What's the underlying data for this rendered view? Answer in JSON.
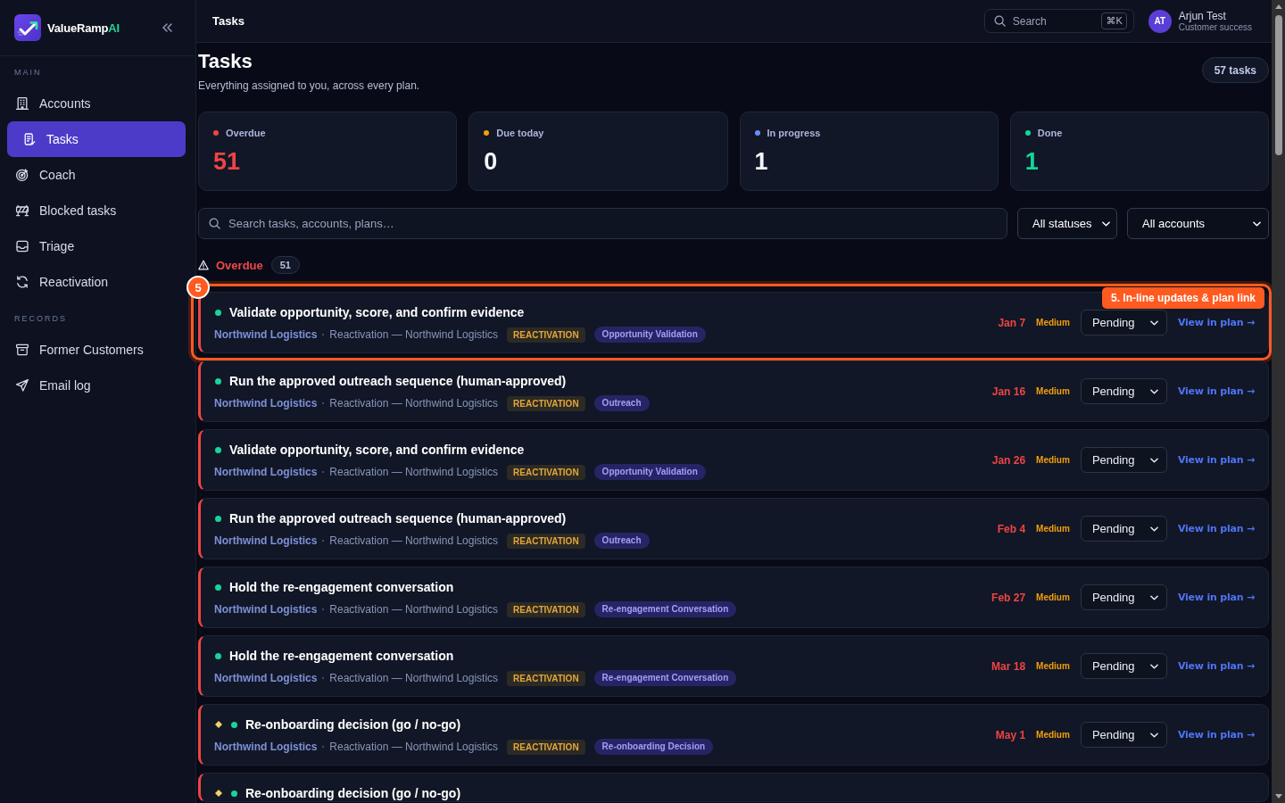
{
  "sidebar": {
    "brand": {
      "name": "ValueRamp",
      "accent": "AI"
    },
    "sections": [
      {
        "label": "MAIN",
        "items": [
          {
            "label": "Accounts",
            "selected": false
          },
          {
            "label": "Tasks",
            "selected": true
          },
          {
            "label": "Coach",
            "selected": false
          },
          {
            "label": "Blocked tasks",
            "selected": false
          },
          {
            "label": "Triage",
            "selected": false
          },
          {
            "label": "Reactivation",
            "selected": false
          }
        ]
      },
      {
        "label": "RECORDS",
        "items": [
          {
            "label": "Former Customers",
            "selected": false
          },
          {
            "label": "Email log",
            "selected": false
          }
        ]
      }
    ]
  },
  "header": {
    "title": "Tasks",
    "search": {
      "placeholder": "Search",
      "shortcut": "⌘K"
    },
    "user": {
      "initials": "AT",
      "name": "Arjun Test",
      "role": "Customer success"
    }
  },
  "page": {
    "title": "Tasks",
    "subtitle": "Everything assigned to you, across every plan.",
    "count": "57 tasks"
  },
  "stats": [
    {
      "label": "Overdue",
      "value": "51",
      "color": "#ef4444",
      "kind": "danger"
    },
    {
      "label": "Due today",
      "value": "0",
      "color": "#f59e0b",
      "kind": "neutral"
    },
    {
      "label": "In progress",
      "value": "1",
      "color": "#6b8cff",
      "kind": "neutral"
    },
    {
      "label": "Done",
      "value": "1",
      "color": "#10d89a",
      "kind": "success"
    }
  ],
  "filters": {
    "search": {
      "placeholder": "Search tasks, accounts, plans…"
    },
    "selects": [
      {
        "value": "All statuses"
      },
      {
        "value": "All accounts"
      }
    ]
  },
  "section": {
    "title": "Overdue",
    "count": "51"
  },
  "tasks": [
    {
      "title": "Validate opportunity, score, and confirm evidence",
      "diamond": false,
      "highlighted": true,
      "account": "Northwind Logistics",
      "plan": "Reactivation — Northwind Logistics",
      "tags": [
        {
          "label": "REACTIVATION",
          "kind": "type"
        },
        {
          "label": "Opportunity Validation",
          "kind": "stage"
        }
      ],
      "due": "Jan 7",
      "priority": "Medium",
      "status": "Pending",
      "link": "View in plan →"
    },
    {
      "title": "Run the approved outreach sequence (human-approved)",
      "diamond": false,
      "highlighted": false,
      "account": "Northwind Logistics",
      "plan": "Reactivation — Northwind Logistics",
      "tags": [
        {
          "label": "REACTIVATION",
          "kind": "type"
        },
        {
          "label": "Outreach",
          "kind": "stage"
        }
      ],
      "due": "Jan 16",
      "priority": "Medium",
      "status": "Pending",
      "link": "View in plan →"
    },
    {
      "title": "Validate opportunity, score, and confirm evidence",
      "diamond": false,
      "highlighted": false,
      "account": "Northwind Logistics",
      "plan": "Reactivation — Northwind Logistics",
      "tags": [
        {
          "label": "REACTIVATION",
          "kind": "type"
        },
        {
          "label": "Opportunity Validation",
          "kind": "stage"
        }
      ],
      "due": "Jan 26",
      "priority": "Medium",
      "status": "Pending",
      "link": "View in plan →"
    },
    {
      "title": "Run the approved outreach sequence (human-approved)",
      "diamond": false,
      "highlighted": false,
      "account": "Northwind Logistics",
      "plan": "Reactivation — Northwind Logistics",
      "tags": [
        {
          "label": "REACTIVATION",
          "kind": "type"
        },
        {
          "label": "Outreach",
          "kind": "stage"
        }
      ],
      "due": "Feb 4",
      "priority": "Medium",
      "status": "Pending",
      "link": "View in plan →"
    },
    {
      "title": "Hold the re-engagement conversation",
      "diamond": false,
      "highlighted": false,
      "account": "Northwind Logistics",
      "plan": "Reactivation — Northwind Logistics",
      "tags": [
        {
          "label": "REACTIVATION",
          "kind": "type"
        },
        {
          "label": "Re-engagement Conversation",
          "kind": "stage"
        }
      ],
      "due": "Feb 27",
      "priority": "Medium",
      "status": "Pending",
      "link": "View in plan →"
    },
    {
      "title": "Hold the re-engagement conversation",
      "diamond": false,
      "highlighted": false,
      "account": "Northwind Logistics",
      "plan": "Reactivation — Northwind Logistics",
      "tags": [
        {
          "label": "REACTIVATION",
          "kind": "type"
        },
        {
          "label": "Re-engagement Conversation",
          "kind": "stage"
        }
      ],
      "due": "Mar 18",
      "priority": "Medium",
      "status": "Pending",
      "link": "View in plan →"
    },
    {
      "title": "Re-onboarding decision (go / no-go)",
      "diamond": true,
      "highlighted": false,
      "account": "Northwind Logistics",
      "plan": "Reactivation — Northwind Logistics",
      "tags": [
        {
          "label": "REACTIVATION",
          "kind": "type"
        },
        {
          "label": "Re-onboarding Decision",
          "kind": "stage"
        }
      ],
      "due": "May 1",
      "priority": "Medium",
      "status": "Pending",
      "link": "View in plan →"
    },
    {
      "title": "Re-onboarding decision (go / no-go)",
      "diamond": true,
      "highlighted": false
    }
  ],
  "tour": {
    "badge": "5",
    "tooltip": "5. In-line updates & plan link"
  }
}
